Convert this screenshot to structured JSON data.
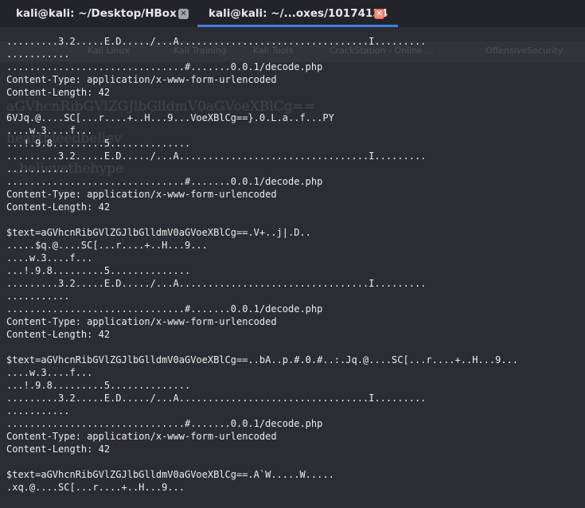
{
  "tabs": [
    {
      "title": "kali@kali: ~/Desktop/HBox",
      "active": false
    },
    {
      "title": "kali@kali: ~/...oxes/10174134",
      "active": true
    }
  ],
  "background_ghost": {
    "bookmarks": [
      "Kali Linux",
      "Kali Training",
      "Kali Tools",
      "CrackStation - Online ...",
      "OffensiveSecurity"
    ],
    "texts": [
      "aGVhcnRibGVlZGJlbGlldmV0aGVoeXBlCg==",
      "heartbleedbeliev",
      "...believethehype"
    ]
  },
  "colors": {
    "terminal_bg": "#2c2d34",
    "tabbar_bg": "#23242a",
    "text": "#ececec",
    "active_tab_underline": "#3f7fe0",
    "active_tab_close": "#f08f80"
  },
  "terminal_lines": [
    ".........3.2.....E.D...../...A.................................I.........",
    "...........",
    "...............................#.......0.0.1/decode.php",
    "Content-Type: application/x-www-form-urlencoded",
    "Content-Length: 42",
    "",
    "6VJq.@....SC[...r....+..H...9...VoeXBlCg==}.0.L.a..f...PY",
    "....w.3....f...",
    "...!.9.8.........5..............",
    ".........3.2.....E.D...../...A.................................I.........",
    "...........",
    "...............................#.......0.0.1/decode.php",
    "Content-Type: application/x-www-form-urlencoded",
    "Content-Length: 42",
    "",
    "$text=aGVhcnRibGVlZGJlbGlldmV0aGVoeXBlCg==.V+..j|.D..",
    ".....$q.@....SC[...r....+..H...9...",
    "....w.3....f...",
    "...!.9.8.........5..............",
    ".........3.2.....E.D...../...A.................................I.........",
    "...........",
    "...............................#.......0.0.1/decode.php",
    "Content-Type: application/x-www-form-urlencoded",
    "Content-Length: 42",
    "",
    "$text=aGVhcnRibGVlZGJlbGlldmV0aGVoeXBlCg==..bA..p.#.0.#..:.Jq.@....SC[...r....+..H...9...",
    "....w.3....f...",
    "...!.9.8.........5..............",
    ".........3.2.....E.D...../...A.................................I.........",
    "...........",
    "...............................#.......0.0.1/decode.php",
    "Content-Type: application/x-www-form-urlencoded",
    "Content-Length: 42",
    "",
    "$text=aGVhcnRibGVlZGJlbGlldmV0aGVoeXBlCg==.A`W.....W.....",
    ".xq.@....SC[...r....+..H...9..."
  ]
}
